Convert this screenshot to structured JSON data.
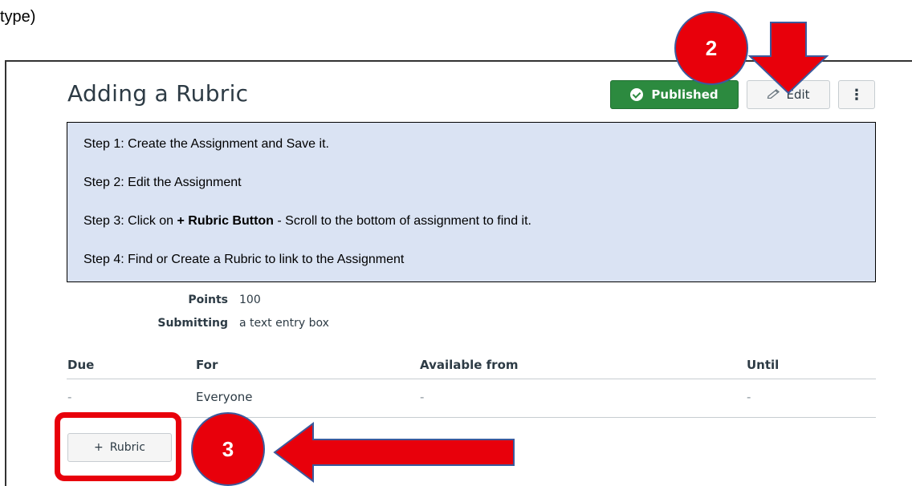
{
  "fragment_text": "type)",
  "page_title": "Adding a Rubric",
  "header_buttons": {
    "published_label": "Published",
    "edit_label": "Edit",
    "more_label": "⋮"
  },
  "steps": {
    "step1": "Step 1: Create the Assignment and Save it.",
    "step2": "Step 2: Edit the Assignment",
    "step3_prefix": "Step 3: Click on ",
    "step3_bold": "+ Rubric Button",
    "step3_suffix": " - Scroll to the bottom of assignment to find it.",
    "step4": "Step 4: Find or Create a Rubric to link to the Assignment"
  },
  "details": {
    "points_label": "Points",
    "points_value": "100",
    "submitting_label": "Submitting",
    "submitting_value": "a text entry box"
  },
  "table": {
    "headers": [
      "Due",
      "For",
      "Available from",
      "Until"
    ],
    "rows": [
      [
        "-",
        "Everyone",
        "-",
        "-"
      ]
    ]
  },
  "rubric_button": {
    "plus": "+",
    "label": "Rubric"
  },
  "annotations": {
    "badge_edit": "2",
    "badge_rubric": "3",
    "accent_color": "#e8000b",
    "published_color": "#2c8a3f",
    "steps_bg_color": "#dae3f3"
  }
}
